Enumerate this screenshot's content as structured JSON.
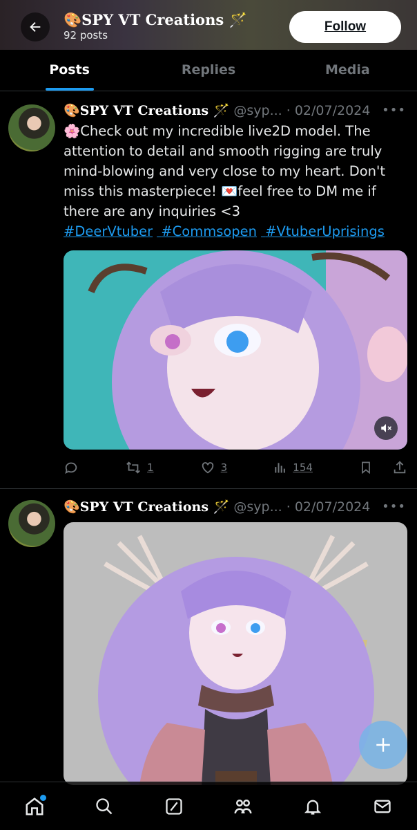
{
  "header": {
    "title": "🎨SPY VT Creations 🪄",
    "posts_count": "92 posts",
    "follow_label": "Follow"
  },
  "tabs": [
    {
      "label": "Posts",
      "active": true
    },
    {
      "label": "Replies",
      "active": false
    },
    {
      "label": "Media",
      "active": false
    }
  ],
  "posts": [
    {
      "author": "🎨SPY VT Creations 🪄",
      "handle": "@syp...",
      "dot": "·",
      "date": "02/07/2024",
      "text": "🌸Check out my incredible live2D model. The attention to detail and smooth rigging are truly mind-blowing and very close to my heart. Don't miss this masterpiece! 💌feel free to DM me if there are any inquiries <3",
      "hashtags": [
        "#DeerVtuber",
        "#Commsopen",
        "#VtuberUprisings"
      ],
      "stats": {
        "reposts": "1",
        "likes": "3",
        "views": "154"
      }
    },
    {
      "author": "🎨SPY VT Creations 🪄",
      "handle": "@syp...",
      "dot": "·",
      "date": "02/07/2024"
    }
  ],
  "icons": {
    "back": "back-arrow-icon",
    "more": "more-icon",
    "reply": "reply-icon",
    "repost": "repost-icon",
    "like": "like-icon",
    "views": "views-icon",
    "bookmark": "bookmark-icon",
    "share": "share-icon",
    "mute": "mute-icon",
    "compose": "plus-icon"
  },
  "colors": {
    "accent": "#1d9bf0",
    "muted": "#71767b",
    "background": "#000000"
  }
}
